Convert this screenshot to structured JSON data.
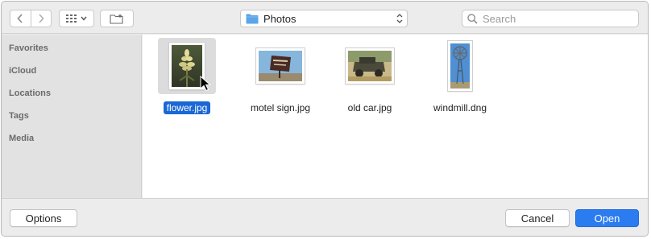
{
  "toolbar": {
    "back_icon": "chevron-left-icon",
    "forward_icon": "chevron-right-icon",
    "view_icon": "grid-view-icon",
    "new_folder_icon": "new-folder-icon",
    "location": "Photos",
    "search_placeholder": "Search"
  },
  "sidebar": {
    "items": [
      "Favorites",
      "iCloud",
      "Locations",
      "Tags",
      "Media"
    ]
  },
  "files": [
    {
      "name": "flower.jpg",
      "selected": true
    },
    {
      "name": "motel sign.jpg",
      "selected": false
    },
    {
      "name": "old car.jpg",
      "selected": false
    },
    {
      "name": "windmill.dng",
      "selected": false
    }
  ],
  "buttons": {
    "options": "Options",
    "cancel": "Cancel",
    "open": "Open"
  },
  "colors": {
    "accent": "#2b7cf0",
    "selection": "#1a67d6",
    "folder": "#5aa6e8"
  }
}
